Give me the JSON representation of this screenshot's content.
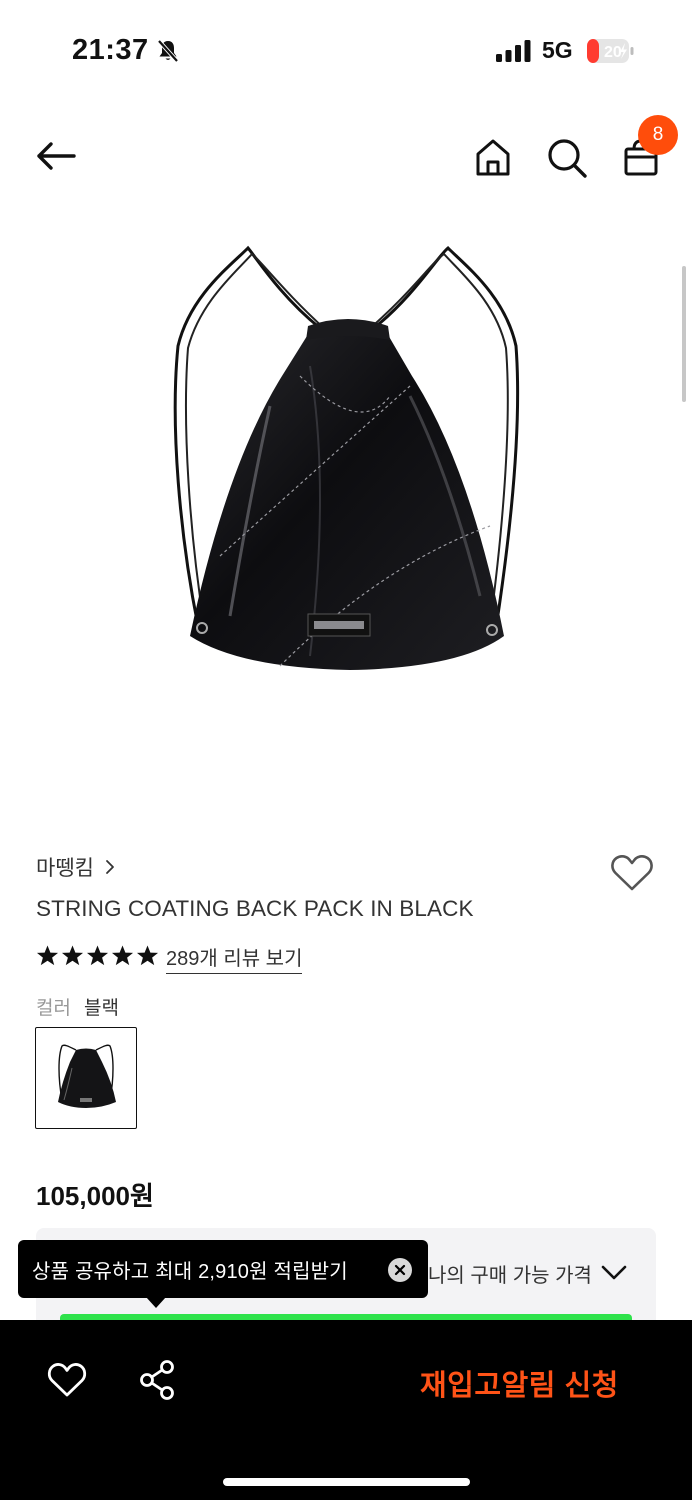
{
  "status_bar": {
    "time": "21:37",
    "network": "5G",
    "battery": "20",
    "icons": [
      "bell-muted-icon",
      "signal-icon",
      "battery-charging-icon"
    ]
  },
  "nav": {
    "icons": [
      "back-arrow-icon",
      "home-icon",
      "search-icon",
      "shopping-bag-icon"
    ],
    "cart_count": "8"
  },
  "product": {
    "image_name": "black-drawstring-backpack",
    "brand": "마뗑킴",
    "name": "STRING COATING BACK PACK IN BLACK",
    "rating_stars": 5,
    "review_link": "289개 리뷰 보기",
    "color_label": "컬러",
    "color_value": "블랙",
    "price": "105,000원"
  },
  "price_box": {
    "my_price_label": "나의 구매 가능 가격"
  },
  "tooltip": {
    "text": "상품 공유하고 최대 2,910원 적립받기"
  },
  "bottom_bar": {
    "restock_label": "재입고알림 신청"
  },
  "colors": {
    "accent_orange": "#ff4d0b",
    "restock_text": "#ff5317",
    "progress_green": "#2ee24b"
  }
}
